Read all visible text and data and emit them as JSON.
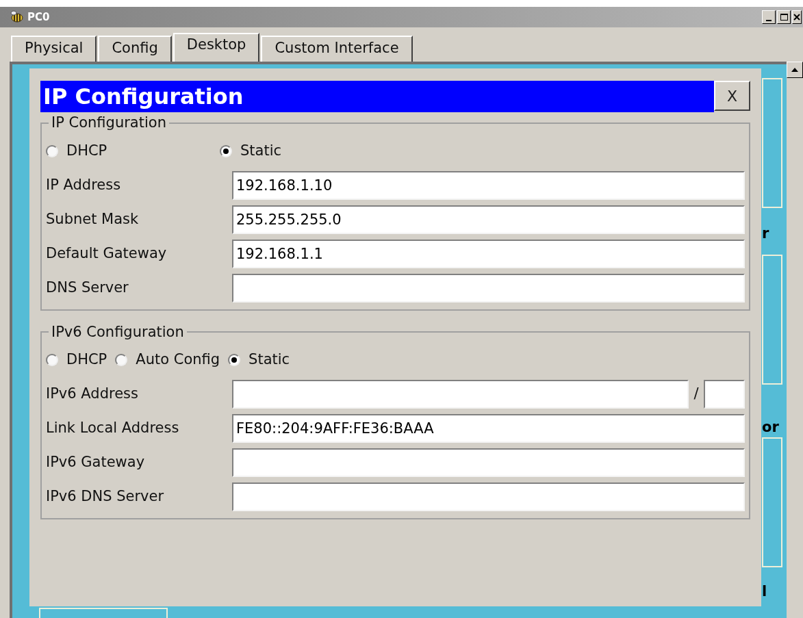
{
  "window": {
    "title": "PC0"
  },
  "tabs": [
    {
      "label": "Physical",
      "selected": false
    },
    {
      "label": "Config",
      "selected": false
    },
    {
      "label": "Desktop",
      "selected": true
    },
    {
      "label": "Custom Interface",
      "selected": false
    }
  ],
  "desktop_labels": [
    "r",
    "or",
    "l"
  ],
  "dialog": {
    "title": "IP Configuration",
    "close": "X",
    "ipv4": {
      "legend": "IP Configuration",
      "modes": [
        {
          "label": "DHCP",
          "selected": false
        },
        {
          "label": "Static",
          "selected": true
        }
      ],
      "fields": [
        {
          "label": "IP Address",
          "value": "192.168.1.10"
        },
        {
          "label": "Subnet Mask",
          "value": "255.255.255.0"
        },
        {
          "label": "Default Gateway",
          "value": "192.168.1.1"
        },
        {
          "label": "DNS Server"
        }
      ]
    },
    "ipv6": {
      "legend": "IPv6 Configuration",
      "modes": [
        {
          "label": "DHCP",
          "selected": false
        },
        {
          "label": "Auto Config",
          "selected": false
        },
        {
          "label": "Static",
          "selected": true
        }
      ],
      "fields": [
        {
          "label": "IPv6 Address",
          "kind": "prefixed",
          "separator": "/"
        },
        {
          "label": "Link Local Address",
          "value": "FE80::204:9AFF:FE36:BAAA"
        },
        {
          "label": "IPv6 Gateway"
        },
        {
          "label": "IPv6 DNS Server"
        }
      ]
    }
  }
}
